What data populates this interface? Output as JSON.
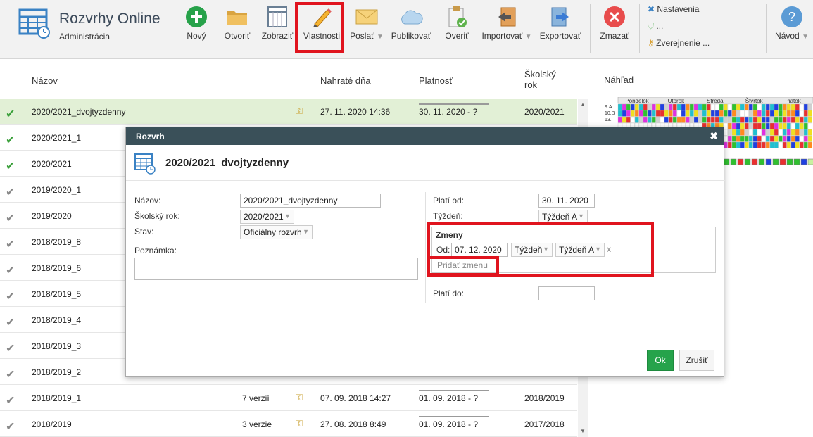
{
  "app": {
    "title": "Rozvrhy Online",
    "subtitle": "Administrácia"
  },
  "toolbar": [
    {
      "key": "new",
      "label": "Nový"
    },
    {
      "key": "open",
      "label": "Otvoriť"
    },
    {
      "key": "show",
      "label": "Zobraziť"
    },
    {
      "key": "props",
      "label": "Vlastnosti"
    },
    {
      "key": "send",
      "label": "Poslať"
    },
    {
      "key": "publish",
      "label": "Publikovať"
    },
    {
      "key": "verify",
      "label": "Overiť"
    },
    {
      "key": "import",
      "label": "Importovať"
    },
    {
      "key": "export",
      "label": "Exportovať"
    },
    {
      "key": "delete",
      "label": "Zmazať"
    },
    {
      "key": "help",
      "label": "Návod"
    }
  ],
  "side_menu": {
    "settings": "Nastavenia",
    "dots": "...",
    "publishing": "Zverejnenie ..."
  },
  "list": {
    "headers": {
      "name": "Názov",
      "uploaded": "Nahraté dňa",
      "validity": "Platnosť",
      "year": "Školský rok"
    },
    "rows": [
      {
        "name": "2020/2021_dvojtyzdenny",
        "versions": "",
        "uploaded": "27. 11. 2020 14:36",
        "validity": "30. 11. 2020 - ?",
        "year": "2020/2021"
      },
      {
        "name": "2020/2021_1",
        "versions": "",
        "uploaded": "",
        "validity": "",
        "year": ""
      },
      {
        "name": "2020/2021",
        "versions": "",
        "uploaded": "",
        "validity": "",
        "year": ""
      },
      {
        "name": "2019/2020_1",
        "versions": "",
        "uploaded": "",
        "validity": "",
        "year": ""
      },
      {
        "name": "2019/2020",
        "versions": "",
        "uploaded": "",
        "validity": "",
        "year": ""
      },
      {
        "name": "2018/2019_8",
        "versions": "",
        "uploaded": "",
        "validity": "",
        "year": ""
      },
      {
        "name": "2018/2019_6",
        "versions": "",
        "uploaded": "",
        "validity": "",
        "year": ""
      },
      {
        "name": "2018/2019_5",
        "versions": "",
        "uploaded": "",
        "validity": "",
        "year": ""
      },
      {
        "name": "2018/2019_4",
        "versions": "",
        "uploaded": "",
        "validity": "",
        "year": ""
      },
      {
        "name": "2018/2019_3",
        "versions": "",
        "uploaded": "",
        "validity": "",
        "year": ""
      },
      {
        "name": "2018/2019_2",
        "versions": "",
        "uploaded": "",
        "validity": "",
        "year": ""
      },
      {
        "name": "2018/2019_1",
        "versions": "7 verzií",
        "uploaded": "07. 09. 2018 14:27",
        "validity": "01. 09. 2018 - ?",
        "year": "2018/2019"
      },
      {
        "name": "2018/2019",
        "versions": "3 verzie",
        "uploaded": "27. 08. 2018 8:49",
        "validity": "01. 09. 2018 - ?",
        "year": "2017/2018"
      }
    ]
  },
  "preview": {
    "label": "Náhľad",
    "days": [
      "Pondelok",
      "Utorok",
      "Streda",
      "Štvrtok",
      "Piatok"
    ],
    "classes": [
      "9.A",
      "10.B",
      "13."
    ]
  },
  "dialog": {
    "header": "Rozvrh",
    "title": "2020/2021_dvojtyzdenny",
    "name_label": "Názov:",
    "name_value": "2020/2021_dvojtyzdenny",
    "year_label": "Školský rok:",
    "year_value": "2020/2021",
    "status_label": "Stav:",
    "status_value": "Oficiálny rozvrh",
    "note_label": "Poznámka:",
    "valid_from_label": "Platí od:",
    "valid_from_value": "30. 11. 2020",
    "week_label": "Týždeň:",
    "week_value": "Týždeň A",
    "changes_title": "Zmeny",
    "changes_from_label": "Od:",
    "changes_from_value": "07. 12. 2020",
    "changes_type_value": "Týždeň",
    "changes_week_value": "Týždeň A",
    "changes_remove": "x",
    "add_change": "Pridať zmenu",
    "valid_to_label": "Platí do:",
    "ok": "Ok",
    "cancel": "Zrušiť"
  }
}
